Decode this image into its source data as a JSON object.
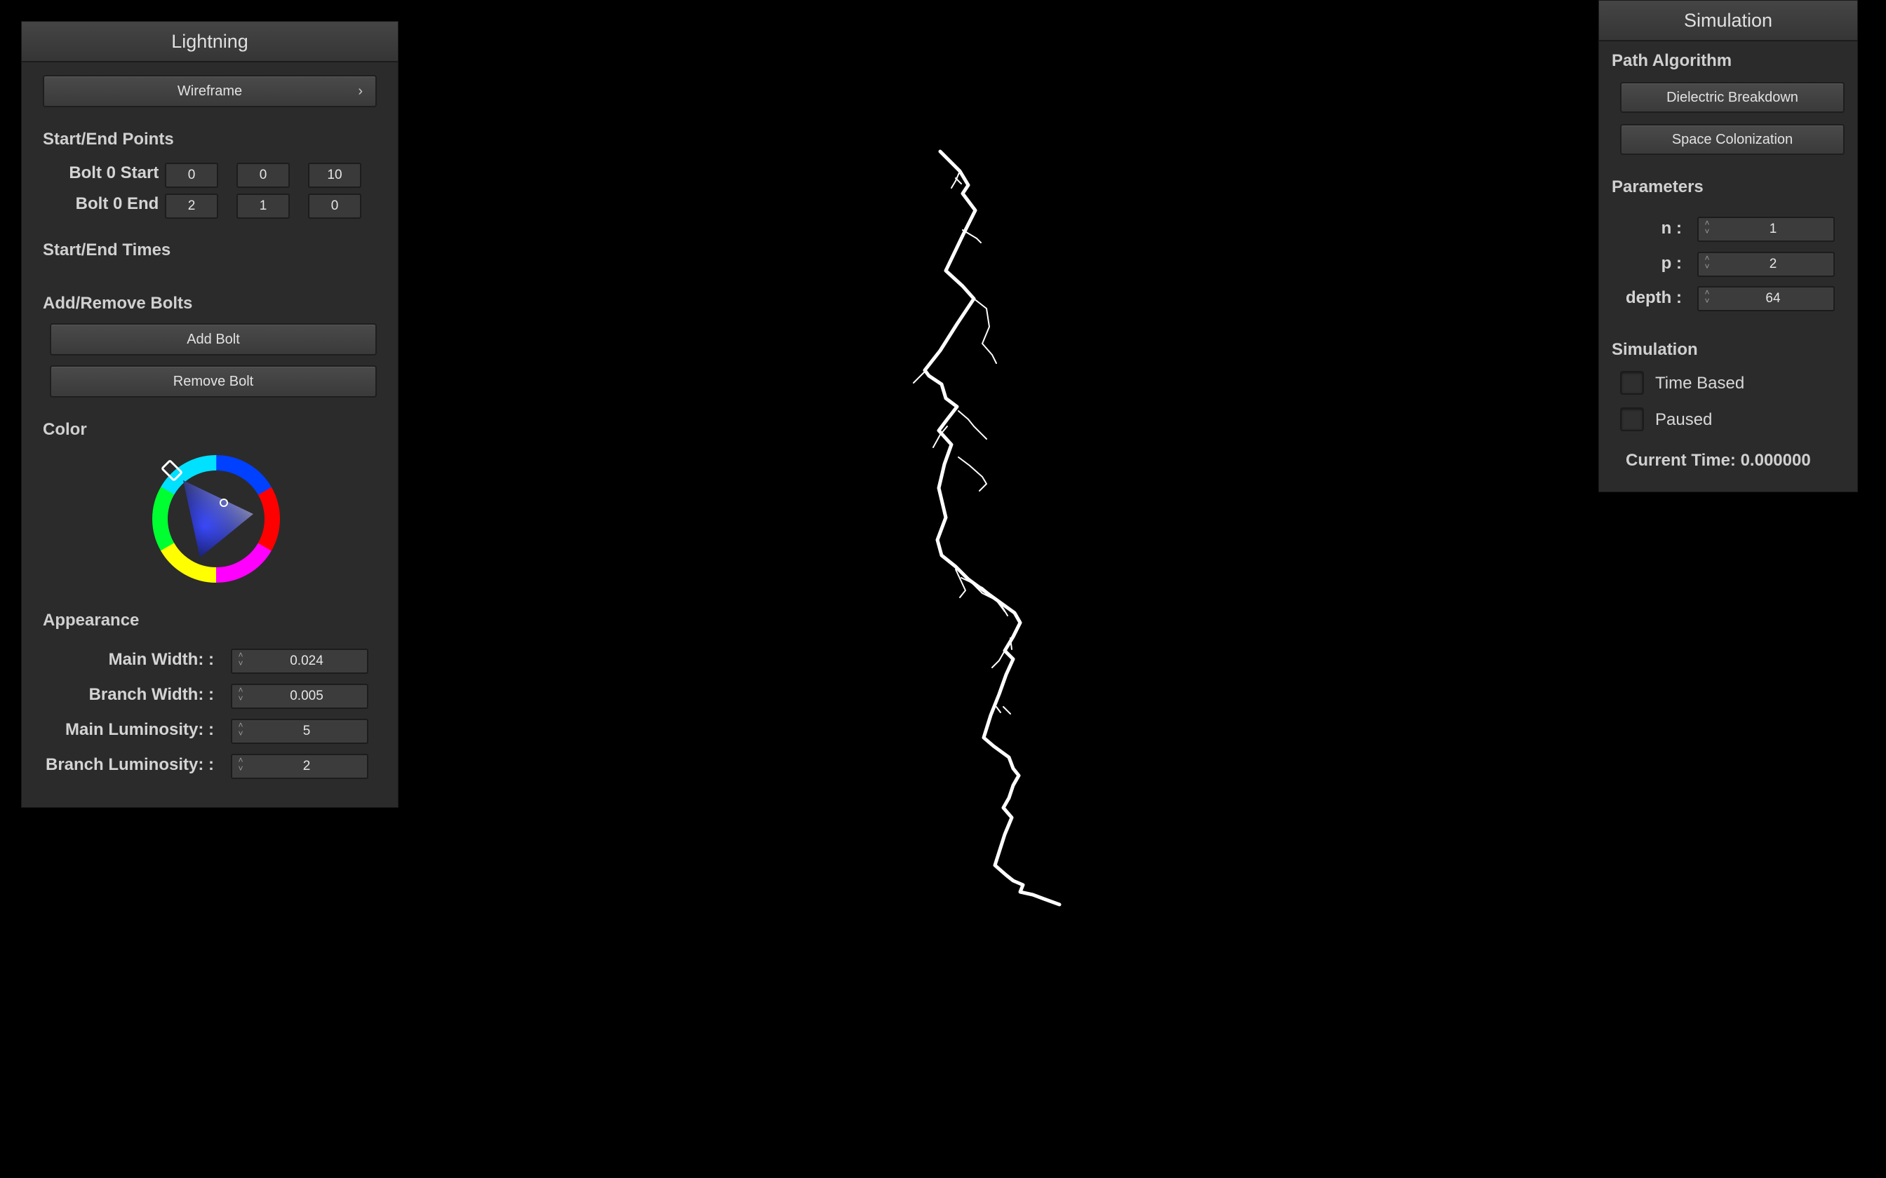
{
  "left_panel": {
    "title": "Lightning",
    "render_mode_button": "Wireframe",
    "start_end_points_header": "Start/End Points",
    "bolt_start_label": "Bolt 0 Start :",
    "bolt_start_values": [
      "0",
      "0",
      "10"
    ],
    "bolt_end_label": "Bolt 0 End :",
    "bolt_end_values": [
      "2",
      "1",
      "0"
    ],
    "start_end_times_header": "Start/End Times",
    "add_remove_header": "Add/Remove Bolts",
    "add_bolt_label": "Add Bolt",
    "remove_bolt_label": "Remove Bolt",
    "color_header": "Color",
    "appearance_header": "Appearance",
    "appearance_fields": [
      {
        "label": "Main Width: :",
        "value": "0.024"
      },
      {
        "label": "Branch Width: :",
        "value": "0.005"
      },
      {
        "label": "Main Luminosity: :",
        "value": "5"
      },
      {
        "label": "Branch Luminosity: :",
        "value": "2"
      }
    ]
  },
  "right_panel": {
    "title": "Simulation",
    "path_algorithm_header": "Path Algorithm",
    "dielectric_label": "Dielectric Breakdown",
    "space_colonization_label": "Space Colonization",
    "parameters_header": "Parameters",
    "parameters": [
      {
        "label": "n :",
        "value": "1"
      },
      {
        "label": "p :",
        "value": "2"
      },
      {
        "label": "depth :",
        "value": "64"
      }
    ],
    "simulation_header": "Simulation",
    "time_based_label": "Time Based",
    "time_based_checked": false,
    "paused_label": "Paused",
    "paused_checked": false,
    "current_time_label": "Current Time: 0.000000"
  },
  "colors": {
    "background": "#000000",
    "panel": "#2b2b2b",
    "bolt": "#ffffff",
    "color_wheel_selected": "#2a3cff"
  }
}
